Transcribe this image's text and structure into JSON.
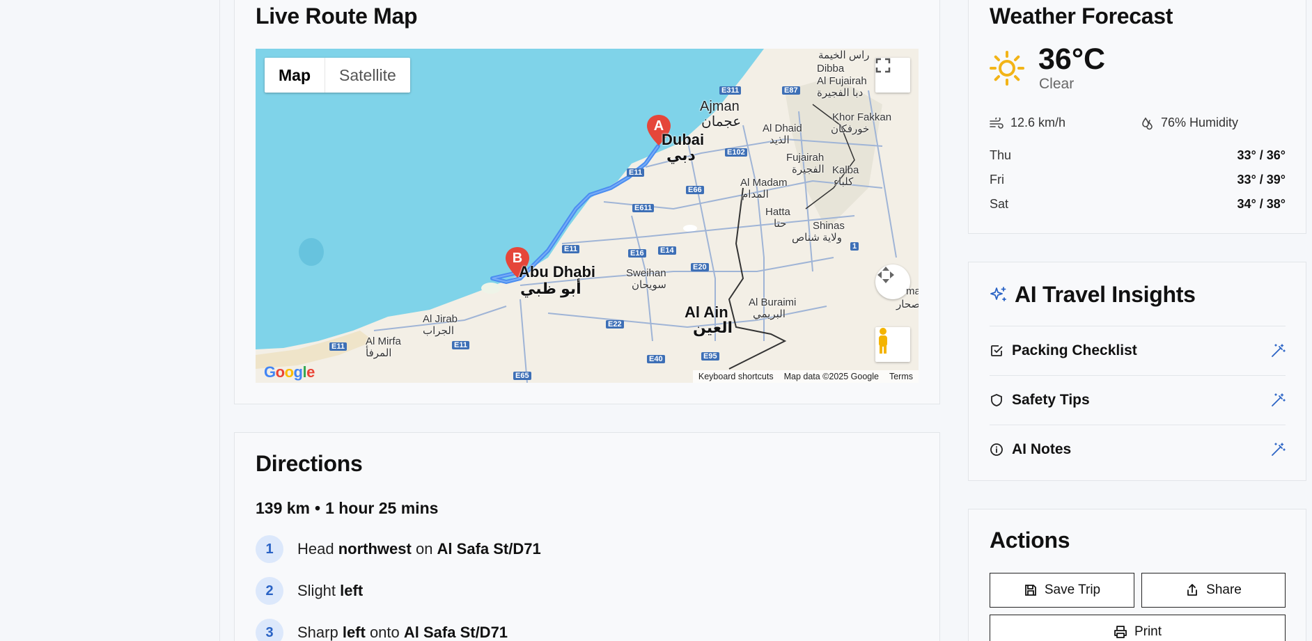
{
  "map": {
    "title": "Live Route Map",
    "type_map": "Map",
    "type_satellite": "Satellite",
    "google": "Google",
    "attribution": [
      "Keyboard shortcuts",
      "Map data ©2025 Google",
      "Terms"
    ],
    "markers": [
      "A",
      "B"
    ],
    "labels": {
      "dubai": "Dubai",
      "dubai_ar": "دبي",
      "abu_dhabi": "Abu Dhabi",
      "abu_dhabi_ar": "أبو ظبي",
      "ajman": "Ajman",
      "ajman_ar": "عجمان",
      "al_ain": "Al Ain",
      "al_ain_ar": "العين",
      "dibba": "Dibba",
      "al_fujairah": "Al Fujairah",
      "al_fujairah_ar": "دبا الفجيرة",
      "khor_fakkan": "Khor Fakkan",
      "khor_fakkan_ar": "خورفكان",
      "al_dhaid": "Al Dhaid",
      "al_dhaid_ar": "الذيد",
      "fujairah": "Fujairah",
      "fujairah_ar": "الفجيرة",
      "kalba": "Kalba",
      "kalba_ar": "كلباء",
      "al_madam": "Al Madam",
      "al_madam_ar": "المدام",
      "hatta": "Hatta",
      "hatta_ar": "حتا",
      "shinas": "Shinas",
      "shinas_ar": "ولاية شناص",
      "sweihan": "Sweihan",
      "sweihan_ar": "سويحان",
      "al_buraimi": "Al Buraimi",
      "al_buraimi_ar": "البريمي",
      "al_jirab": "Al Jirab",
      "al_jirab_ar": "الجراب",
      "al_mirfa": "Al Mirfa",
      "al_mirfa_ar": "المرفأ",
      "ras_al_khaimah_ar": "راس الخيمة",
      "sohar_frag": "ma",
      "sohar_ar_frag": "صحار"
    },
    "highways": [
      "E311",
      "E87",
      "E102",
      "E11",
      "E66",
      "E611",
      "E11",
      "E16",
      "E14",
      "E20",
      "E22",
      "E11",
      "E11",
      "E40",
      "E95",
      "E65",
      "1"
    ]
  },
  "directions": {
    "title": "Directions",
    "distance": "139 km",
    "separator": "•",
    "duration": "1 hour 25 mins",
    "steps": [
      {
        "num": "1",
        "pre": "Head ",
        "b1": "northwest",
        "mid": " on ",
        "b2": "Al Safa St/D71"
      },
      {
        "num": "2",
        "pre": "Slight ",
        "b1": "left",
        "mid": "",
        "b2": ""
      },
      {
        "num": "3",
        "pre": "Sharp ",
        "b1": "left",
        "mid": " onto ",
        "b2": "Al Safa St/D71"
      }
    ]
  },
  "weather": {
    "title": "Weather Forecast",
    "temp": "36°C",
    "condition": "Clear",
    "wind": "12.6 km/h",
    "humidity": "76% Humidity",
    "forecast": [
      {
        "day": "Thu",
        "range": "33° / 36°"
      },
      {
        "day": "Fri",
        "range": "33° / 39°"
      },
      {
        "day": "Sat",
        "range": "34° / 38°"
      }
    ],
    "sun_color": "#f2b418"
  },
  "ai": {
    "title": "AI Travel Insights",
    "items": [
      "Packing Checklist",
      "Safety Tips",
      "AI Notes"
    ],
    "accent": "#2a63c5"
  },
  "actions": {
    "title": "Actions",
    "save": "Save Trip",
    "share": "Share",
    "print": "Print"
  }
}
